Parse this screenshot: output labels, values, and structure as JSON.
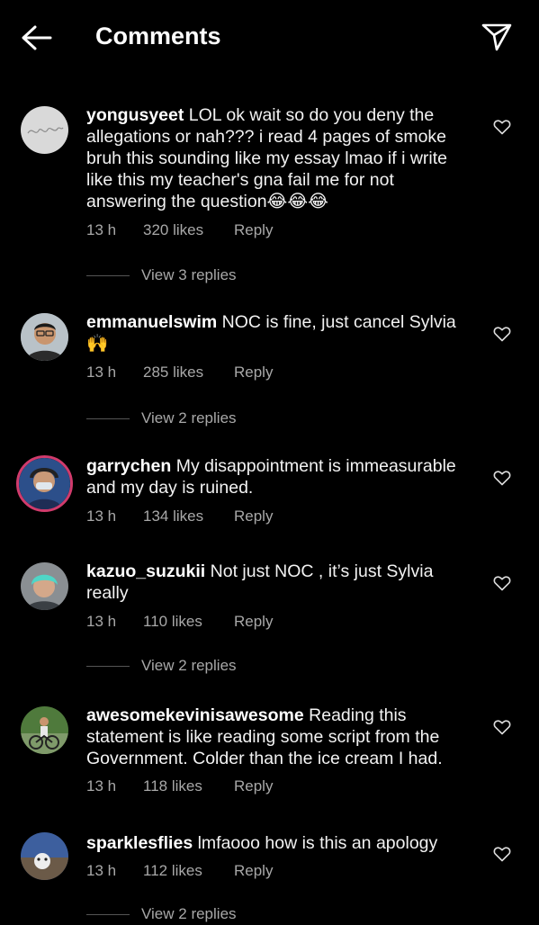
{
  "header": {
    "title": "Comments"
  },
  "comments": [
    {
      "username": "yongusyeet",
      "text": "LOL ok wait so do you deny the allegations or nah??? i read 4 pages of smoke bruh this sounding like my essay lmao if i write like this my teacher's gna fail me for not answering the question😂😂😂",
      "time": "13 h",
      "likes": "320 likes",
      "reply": "Reply",
      "view_replies": "View 3 replies"
    },
    {
      "username": "emmanuelswim",
      "text": "NOC is fine, just cancel Sylvia 🙌",
      "time": "13 h",
      "likes": "285 likes",
      "reply": "Reply",
      "view_replies": "View 2 replies"
    },
    {
      "username": "garrychen",
      "text": "My disappointment is immeasurable and my day is ruined.",
      "time": "13 h",
      "likes": "134 likes",
      "reply": "Reply"
    },
    {
      "username": "kazuo_suzukii",
      "text": "Not just NOC , it’s just Sylvia really",
      "time": "13 h",
      "likes": "110 likes",
      "reply": "Reply",
      "view_replies": "View 2 replies"
    },
    {
      "username": "awesomekevinisawesome",
      "text": "Reading this statement is like reading some script from the Government. Colder than the ice cream I had.",
      "time": "13 h",
      "likes": "118 likes",
      "reply": "Reply"
    },
    {
      "username": "sparklesflies",
      "text": "lmfaooo how is this an apology",
      "time": "13 h",
      "likes": "112 likes",
      "reply": "Reply",
      "view_replies": "View 2 replies"
    }
  ]
}
